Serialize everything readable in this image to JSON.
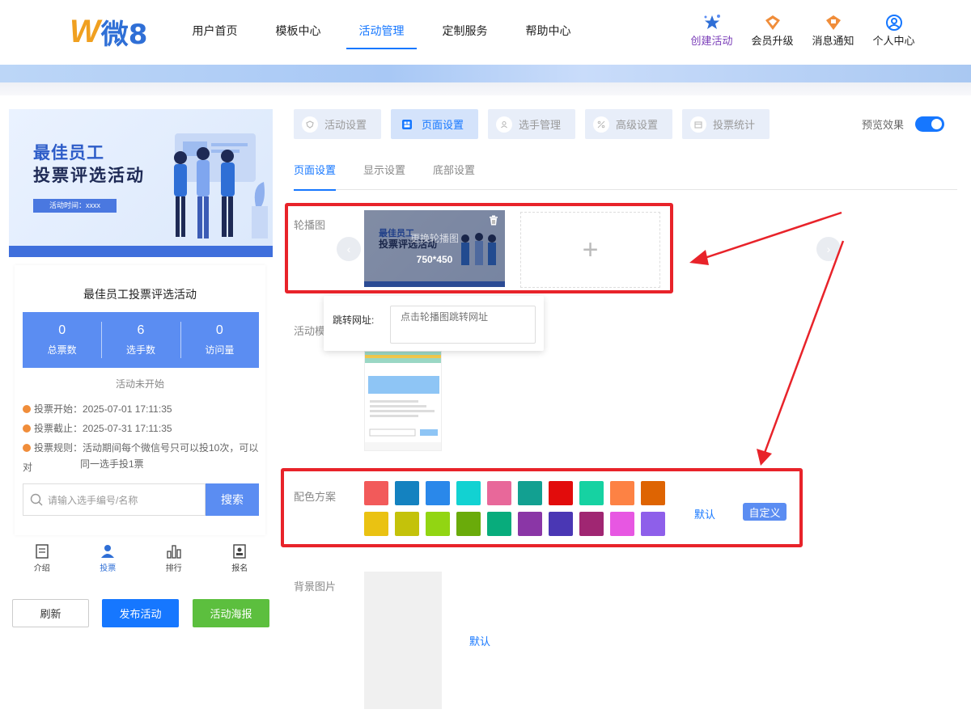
{
  "header": {
    "logo_mark": "W",
    "logo_text": "微8",
    "nav": [
      {
        "label": "用户首页",
        "active": false
      },
      {
        "label": "模板中心",
        "active": false
      },
      {
        "label": "活动管理",
        "active": true
      },
      {
        "label": "定制服务",
        "active": false
      },
      {
        "label": "帮助中心",
        "active": false
      }
    ],
    "actions": [
      {
        "label": "创建活动",
        "icon": "star-icon"
      },
      {
        "label": "会员升级",
        "icon": "diamond-icon"
      },
      {
        "label": "消息通知",
        "icon": "bell-diamond-icon"
      },
      {
        "label": "个人中心",
        "icon": "user-circle-icon"
      }
    ]
  },
  "preview_panel": {
    "hero": {
      "title_line1": "最佳员工",
      "title_line2": "投票评选活动",
      "time": "活动时间：xxxx"
    },
    "activity_title": "最佳员工投票评选活动",
    "stats": [
      {
        "value": "0",
        "label": "总票数"
      },
      {
        "value": "6",
        "label": "选手数"
      },
      {
        "value": "0",
        "label": "访问量"
      }
    ],
    "status": "活动未开始",
    "vote_start": "投票开始：2025-07-01 17:11:35",
    "vote_end": "投票截止：2025-07-31 17:11:35",
    "vote_rule_line1": "投票规则：活动期间每个微信号只可以投10次，可以对",
    "vote_rule_line2": "同一选手投1票",
    "search_placeholder": "请输入选手编号/名称",
    "search_button": "搜索",
    "tabbar": [
      {
        "label": "介绍",
        "icon": "document-icon",
        "active": false
      },
      {
        "label": "投票",
        "icon": "person-icon",
        "active": true
      },
      {
        "label": "排行",
        "icon": "bar-chart-icon",
        "active": false
      },
      {
        "label": "报名",
        "icon": "id-card-icon",
        "active": false
      }
    ],
    "buttons": {
      "refresh": "刷新",
      "publish": "发布活动",
      "poster": "活动海报"
    }
  },
  "settings": {
    "main_tabs": [
      {
        "label": "活动设置",
        "active": false
      },
      {
        "label": "页面设置",
        "active": true
      },
      {
        "label": "选手管理",
        "active": false
      },
      {
        "label": "高级设置",
        "active": false
      },
      {
        "label": "投票统计",
        "active": false
      }
    ],
    "preview_label": "预览效果",
    "preview_enabled": true,
    "sub_tabs": [
      {
        "label": "页面设置",
        "active": true
      },
      {
        "label": "显示设置",
        "active": false
      },
      {
        "label": "底部设置",
        "active": false
      }
    ],
    "carousel": {
      "label": "轮播图",
      "image_title_line1": "最佳员工",
      "image_title_line2": "投票评选活动",
      "replace_text": "更换轮播图",
      "size_text": "750*450",
      "add_symbol": "+"
    },
    "jump_url": {
      "label": "跳转网址:",
      "placeholder": "点击轮播图跳转网址"
    },
    "template_label": "活动模",
    "color_scheme": {
      "label": "配色方案",
      "colors": [
        "#f25a5a",
        "#1482c0",
        "#2a88ea",
        "#12d2d2",
        "#e8689a",
        "#12a091",
        "#e20c0c",
        "#16d2a2",
        "#fd8244",
        "#de6402",
        "#eac212",
        "#c4c20a",
        "#92d512",
        "#6aab0a",
        "#08ac7c",
        "#8a36a6",
        "#4a37b4",
        "#a02672",
        "#e757e2",
        "#8e5fea"
      ],
      "default_label": "默认",
      "custom_label": "自定义"
    },
    "background": {
      "label": "背景图片",
      "default_label": "默认"
    }
  },
  "colors": {
    "accent": "#1677ff",
    "panel_blue": "#5b8df2",
    "highlight_red": "#e8232a"
  }
}
